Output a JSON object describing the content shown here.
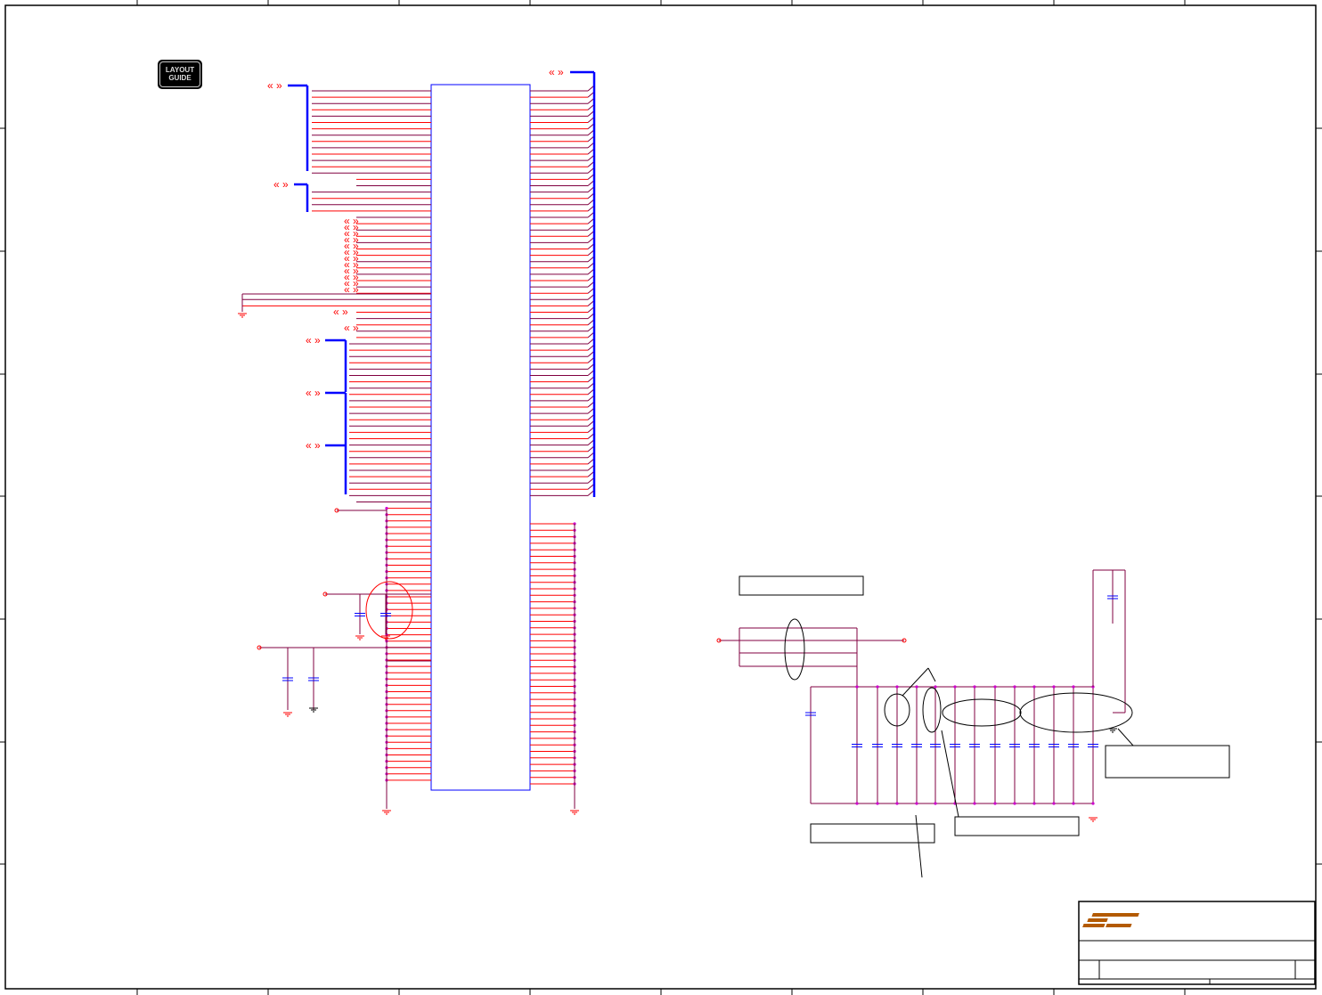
{
  "layout_guide": {
    "line1": "LAYOUT",
    "line2": "GUIDE"
  },
  "title_block": {
    "logo": "FIC"
  },
  "colors": {
    "wire": "#ff0000",
    "bus": "#0000ff",
    "net": "#800040",
    "junction": "#cc00cc",
    "logo": "#b35a00",
    "frame": "#000000"
  }
}
